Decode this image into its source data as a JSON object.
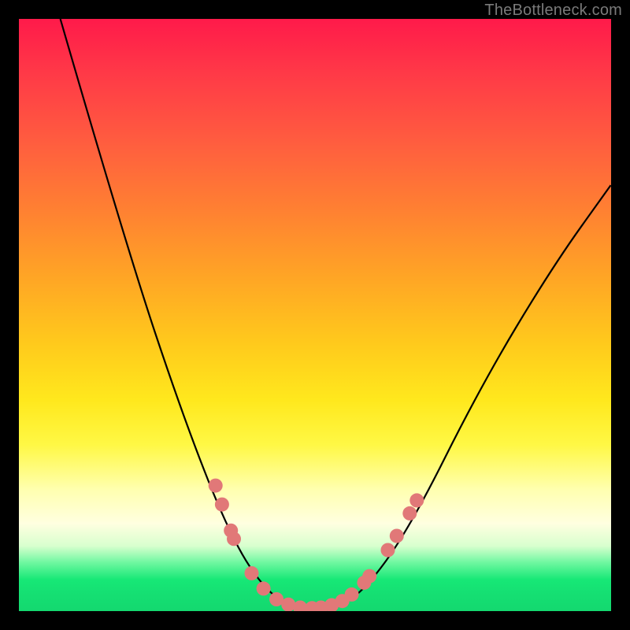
{
  "watermark": "TheBottleneck.com",
  "chart_data": {
    "type": "line",
    "title": "",
    "xlabel": "",
    "ylabel": "",
    "xlim": [
      0,
      100
    ],
    "ylim": [
      0,
      100
    ],
    "curve": {
      "name": "bottleneck-curve",
      "points": [
        {
          "x": 7,
          "y": 100
        },
        {
          "x": 18,
          "y": 62
        },
        {
          "x": 28,
          "y": 32
        },
        {
          "x": 36,
          "y": 12
        },
        {
          "x": 42,
          "y": 3
        },
        {
          "x": 47,
          "y": 0.5
        },
        {
          "x": 53,
          "y": 0.5
        },
        {
          "x": 58,
          "y": 3
        },
        {
          "x": 66,
          "y": 14
        },
        {
          "x": 78,
          "y": 38
        },
        {
          "x": 90,
          "y": 58
        },
        {
          "x": 100,
          "y": 72
        }
      ]
    },
    "markers": {
      "name": "highlight-dots",
      "color": "#e17878",
      "radius_pct": 1.2,
      "points": [
        {
          "x": 33.2,
          "y": 21.2
        },
        {
          "x": 34.3,
          "y": 18.0
        },
        {
          "x": 35.8,
          "y": 13.6
        },
        {
          "x": 36.3,
          "y": 12.2
        },
        {
          "x": 39.3,
          "y": 6.4
        },
        {
          "x": 41.3,
          "y": 3.8
        },
        {
          "x": 43.5,
          "y": 2.0
        },
        {
          "x": 45.5,
          "y": 1.1
        },
        {
          "x": 47.5,
          "y": 0.6
        },
        {
          "x": 49.5,
          "y": 0.5
        },
        {
          "x": 51.0,
          "y": 0.6
        },
        {
          "x": 52.8,
          "y": 1.0
        },
        {
          "x": 54.6,
          "y": 1.7
        },
        {
          "x": 56.2,
          "y": 2.8
        },
        {
          "x": 58.3,
          "y": 4.8
        },
        {
          "x": 59.2,
          "y": 5.9
        },
        {
          "x": 62.3,
          "y": 10.3
        },
        {
          "x": 63.8,
          "y": 12.7
        },
        {
          "x": 66.0,
          "y": 16.5
        },
        {
          "x": 67.2,
          "y": 18.7
        }
      ]
    },
    "background_gradient": {
      "top": "#ff1a4a",
      "mid": "#ffe81d",
      "bottom": "#17e876"
    }
  }
}
